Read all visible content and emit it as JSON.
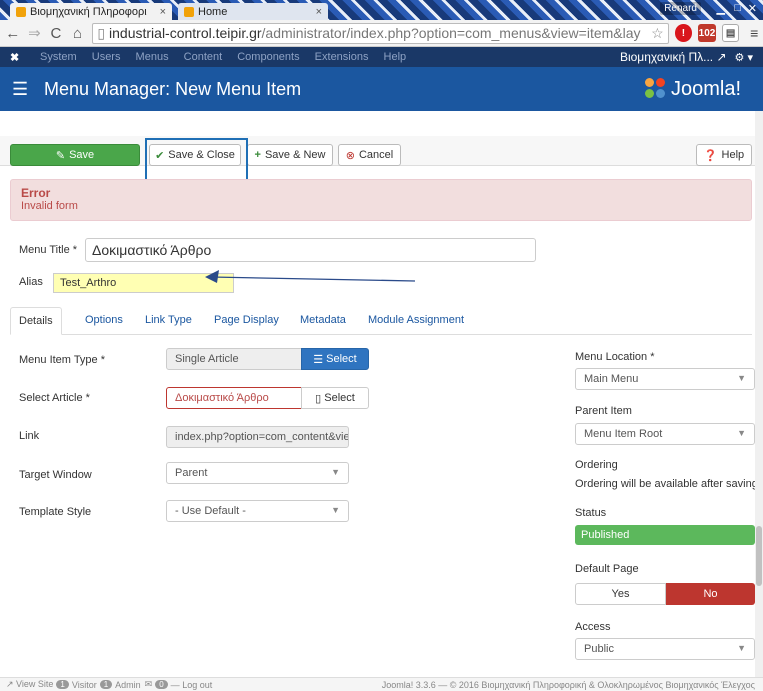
{
  "browser": {
    "tabs": [
      {
        "label": "Βιομηχανική Πληροφορι",
        "close": "×"
      },
      {
        "label": "Home",
        "close": "×"
      }
    ],
    "user_badge": "Renard",
    "url_main": "industrial-control.teipir.gr",
    "url_rest": "/administrator/index.php?option=com_menus&view=item&lay",
    "ext_badge": "102"
  },
  "topbar": {
    "menu": [
      "System",
      "Users",
      "Menus",
      "Content",
      "Components",
      "Extensions",
      "Help"
    ],
    "site_name": "Βιομηχανική Πλ...",
    "gear": "⚙ ▾"
  },
  "header": {
    "title": "Menu Manager: New Menu Item",
    "brand": "Joomla!"
  },
  "toolbar": {
    "save": "Save",
    "save_close": "Save & Close",
    "save_new": "Save & New",
    "cancel": "Cancel",
    "help": "Help"
  },
  "alert": {
    "heading": "Error",
    "message": "Invalid form"
  },
  "form": {
    "menu_title_label": "Menu Title *",
    "menu_title_value": "Δοκιμαστικό Άρθρο",
    "alias_label": "Alias",
    "alias_value": "Test_Arthro"
  },
  "tabs": [
    "Details",
    "Options",
    "Link Type",
    "Page Display",
    "Metadata",
    "Module Assignment"
  ],
  "details": {
    "item_type_label": "Menu Item Type *",
    "item_type_value": "Single Article",
    "item_type_btn": "Select",
    "article_label": "Select Article *",
    "article_value": "Δοκιμαστικό Άρθρο",
    "article_btn": "Select",
    "link_label": "Link",
    "link_value": "index.php?option=com_content&vie",
    "target_label": "Target Window",
    "target_value": "Parent",
    "template_label": "Template Style",
    "template_value": "- Use Default -"
  },
  "side": {
    "location_label": "Menu Location *",
    "location_value": "Main Menu",
    "parent_label": "Parent Item",
    "parent_value": "Menu Item Root",
    "ordering_label": "Ordering",
    "ordering_text": "Ordering will be available after saving",
    "status_label": "Status",
    "status_value": "Published",
    "default_label": "Default Page",
    "yes": "Yes",
    "no": "No",
    "access_label": "Access",
    "access_value": "Public"
  },
  "footer": {
    "view_site": "View Site",
    "visitor_count": "1",
    "visitor": "Visitor",
    "admin_count": "1",
    "admin": "Admin",
    "msg_count": "0",
    "logout": "Log out",
    "copyright": "Joomla! 3.3.6 — © 2016 Βιομηχανική Πληροφορική & Ολοκληρωμένος Βιομηχανικός Έλεγχος"
  },
  "colors": {
    "brand_blue": "#1b57a0",
    "save_green": "#4aa64a",
    "published_green": "#5cb85c",
    "no_red": "#bd362f",
    "highlight": "#1f6fb5"
  }
}
